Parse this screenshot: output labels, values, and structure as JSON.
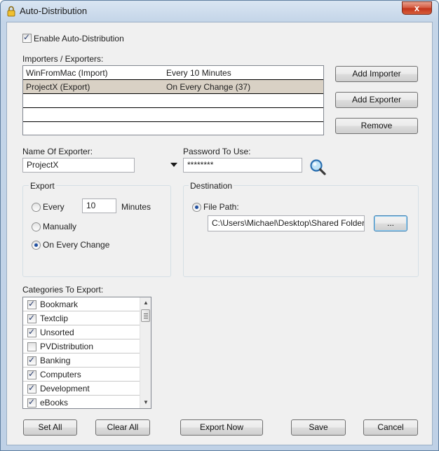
{
  "window": {
    "title": "Auto-Distribution",
    "close_glyph": "x"
  },
  "enable_auto_distribution": {
    "label": "Enable Auto-Distribution",
    "checked": true
  },
  "importers_exporters": {
    "label": "Importers / Exporters:",
    "rows": [
      {
        "name": "WinFromMac (Import)",
        "schedule": "Every 10 Minutes",
        "selected": false
      },
      {
        "name": "ProjectX (Export)",
        "schedule": "On Every Change (37)",
        "selected": true
      },
      {
        "name": "",
        "schedule": "",
        "selected": false
      },
      {
        "name": "",
        "schedule": "",
        "selected": false
      }
    ]
  },
  "buttons": {
    "add_importer": "Add Importer",
    "add_exporter": "Add Exporter",
    "remove": "Remove",
    "browse": "...",
    "set_all": "Set All",
    "clear_all": "Clear All",
    "export_now": "Export Now",
    "save": "Save",
    "cancel": "Cancel"
  },
  "name_of_exporter": {
    "label": "Name Of Exporter:",
    "value": "ProjectX"
  },
  "password": {
    "label": "Password To Use:",
    "value": "********"
  },
  "export_group": {
    "title": "Export",
    "every_label": "Every",
    "every_value": "10",
    "minutes_label": "Minutes",
    "manually_label": "Manually",
    "on_every_change_label": "On Every Change",
    "selected": "on_every_change"
  },
  "destination_group": {
    "title": "Destination",
    "file_path_label": "File Path:",
    "file_path_value": "C:\\Users\\Michael\\Desktop\\Shared Folder"
  },
  "categories": {
    "label": "Categories To Export:",
    "items": [
      {
        "label": "Bookmark",
        "checked": true
      },
      {
        "label": "Textclip",
        "checked": true
      },
      {
        "label": "Unsorted",
        "checked": true
      },
      {
        "label": "PVDistribution",
        "checked": false
      },
      {
        "label": "Banking",
        "checked": true
      },
      {
        "label": "Computers",
        "checked": true
      },
      {
        "label": "Development",
        "checked": true
      },
      {
        "label": "eBooks",
        "checked": true
      }
    ]
  },
  "colors": {
    "selected_row": "#d9d1c5",
    "accent": "#1f4fa0"
  }
}
